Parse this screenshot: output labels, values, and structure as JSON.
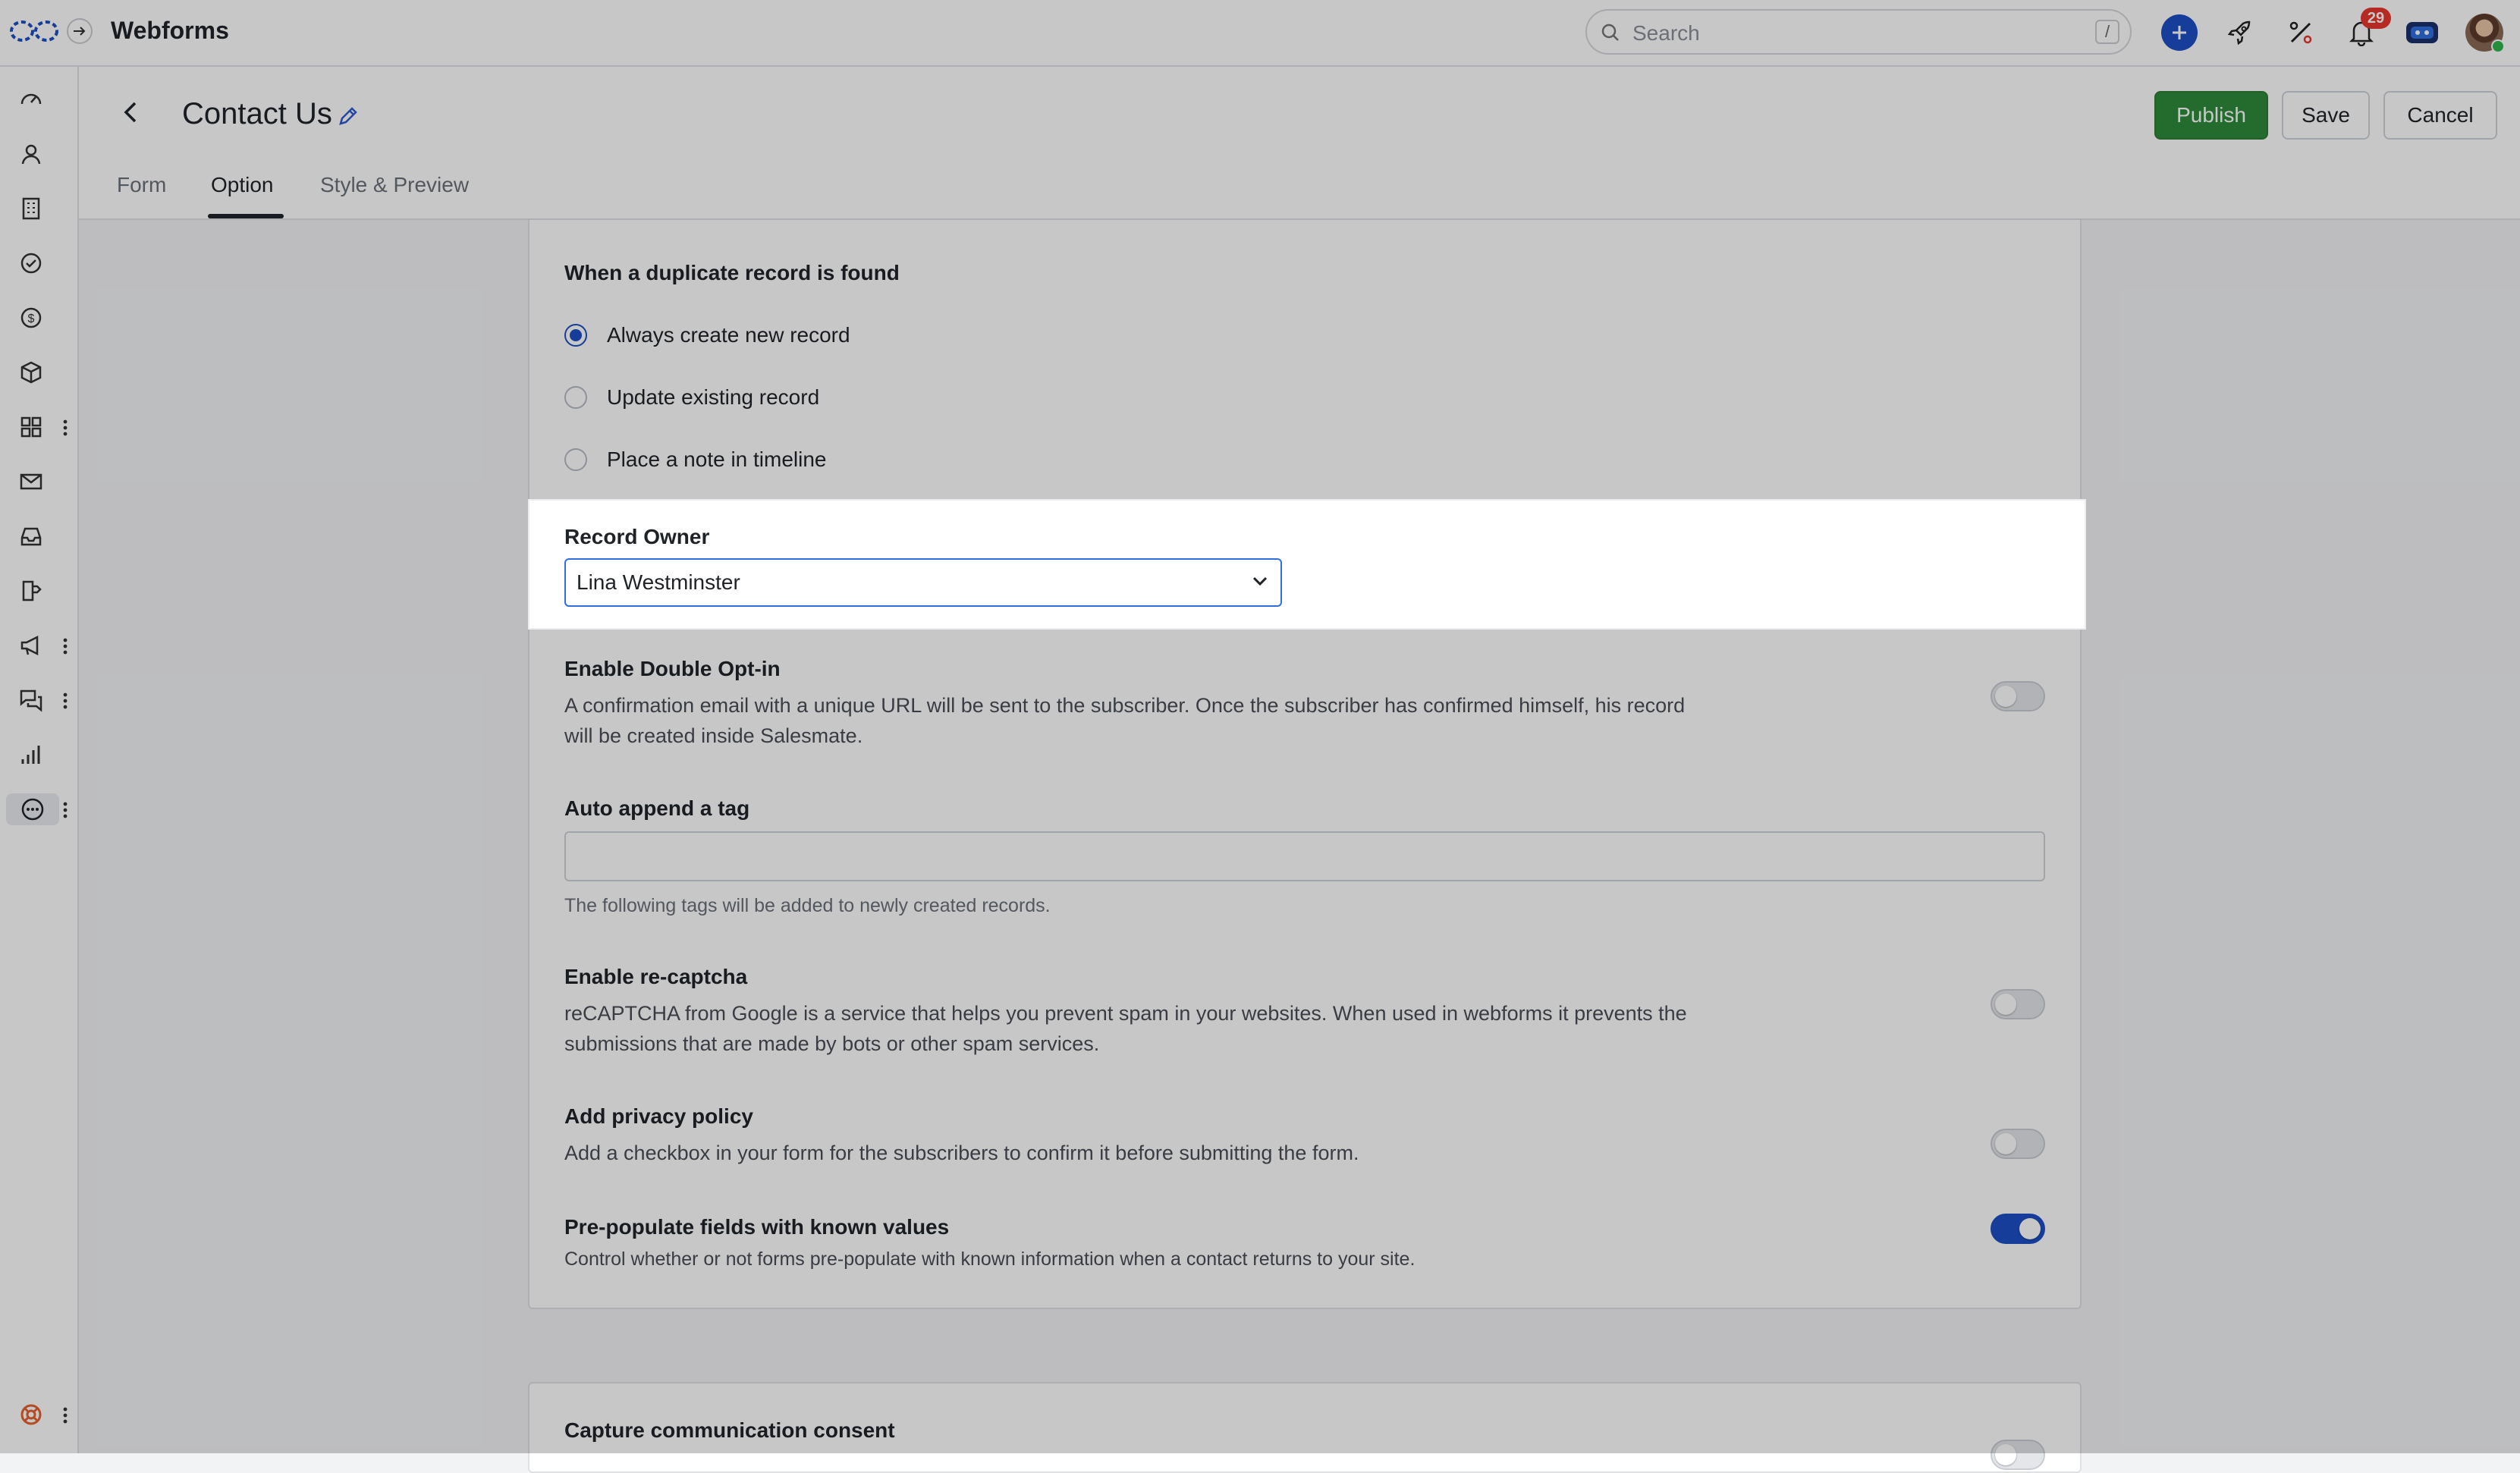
{
  "topbar": {
    "app_title": "Webforms",
    "search_placeholder": "Search",
    "search_shortcut": "/",
    "notification_count": "29"
  },
  "header": {
    "page_title": "Contact Us",
    "publish_label": "Publish",
    "save_label": "Save",
    "cancel_label": "Cancel",
    "tabs": [
      {
        "label": "Form"
      },
      {
        "label": "Option"
      },
      {
        "label": "Style & Preview"
      }
    ]
  },
  "duplicate": {
    "title": "When a duplicate record is found",
    "options": [
      {
        "label": "Always create new record",
        "checked": true
      },
      {
        "label": "Update existing record",
        "checked": false
      },
      {
        "label": "Place a note in timeline",
        "checked": false
      }
    ]
  },
  "record_owner": {
    "title": "Record Owner",
    "value": "Lina Westminster"
  },
  "double_optin": {
    "title": "Enable Double Opt-in",
    "desc_line1": "A confirmation email with a unique URL will be sent to the subscriber. Once the subscriber has confirmed himself, his record",
    "desc_line2": "will be created inside Salesmate.",
    "enabled": false
  },
  "auto_tag": {
    "title": "Auto append a tag",
    "value": "",
    "hint": "The following tags will be added to newly created records."
  },
  "recaptcha": {
    "title": "Enable re-captcha",
    "desc_line1": "reCAPTCHA from Google is a service that helps you prevent spam in your websites. When used in webforms it prevents the",
    "desc_line2": "submissions that are made by bots or other spam services.",
    "enabled": false
  },
  "privacy": {
    "title": "Add privacy policy",
    "desc": "Add a checkbox in your form for the subscribers to confirm it before submitting the form.",
    "enabled": false
  },
  "prepopulate": {
    "title": "Pre-populate fields with known values",
    "desc": "Control whether or not forms pre-populate with known information when a contact returns to your site.",
    "enabled": true
  },
  "consent": {
    "title": "Capture communication consent",
    "enabled": false
  },
  "colors": {
    "accent": "#1d4fc4",
    "publish": "#2e8b3a",
    "badge": "#e8362c"
  },
  "sidebar_icons": [
    "dashboard-icon",
    "contacts-icon",
    "companies-icon",
    "tasks-icon",
    "deals-icon",
    "products-icon",
    "apps-icon",
    "email-icon",
    "inbox-icon",
    "sequences-icon",
    "campaigns-icon",
    "chat-icon",
    "reports-icon",
    "more-icon",
    "help-icon"
  ]
}
